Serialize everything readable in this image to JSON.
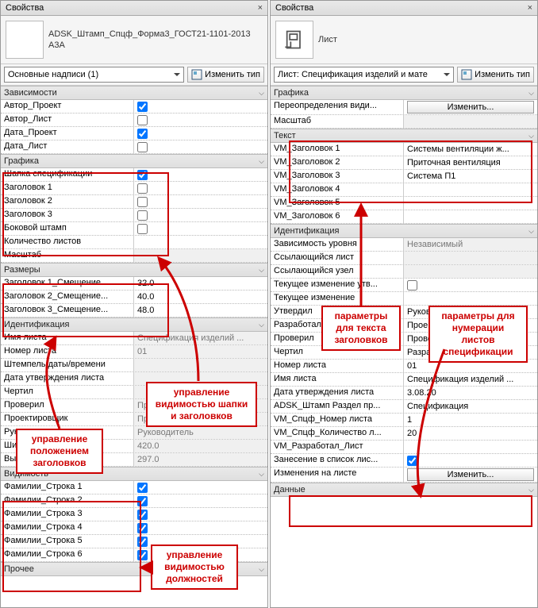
{
  "left": {
    "title": "Свойства",
    "type_name": "ADSK_Штамп_Спцф_Форма3_ГОСТ21-1101-2013\nА3А",
    "selector": "Основные надписи (1)",
    "edit_type": "Изменить тип",
    "sections": {
      "deps": "Зависимости",
      "graphics": "Графика",
      "sizes": "Размеры",
      "ident": "Идентификация",
      "vis": "Видимость",
      "other": "Прочее"
    },
    "rows": {
      "author_project": "Автор_Проект",
      "author_sheet": "Автор_Лист",
      "date_project": "Дата_Проект",
      "date_sheet": "Дата_Лист",
      "spec_header": "Шапка спецификации",
      "head1": "Заголовок 1",
      "head2": "Заголовок 2",
      "head3": "Заголовок 3",
      "side_stamp": "Боковой штамп",
      "sheet_count": "Количество листов",
      "scale": "Масштаб",
      "h1off": "Заголовок 1_Смещение...",
      "h1off_v": "32.0",
      "h2off": "Заголовок 2_Смещение...",
      "h2off_v": "40.0",
      "h3off": "Заголовок 3_Смещение...",
      "h3off_v": "48.0",
      "sheet_name": "Имя листа",
      "sheet_name_v": "Спецификация изделий ...",
      "sheet_num": "Номер листа",
      "sheet_num_v": "01",
      "datestamp": "Штемпель даты/времени",
      "approve_date": "Дата утверждения листа",
      "drew": "Чертил",
      "checked": "Проверил",
      "checked_v": "Проверил",
      "designer": "Проектировщик",
      "designer_v": "Проектировщик",
      "lead": "Руководитель",
      "lead_v": "Руководитель",
      "sheet_w": "Ширина листа",
      "sheet_w_v": "420.0",
      "sheet_h": "Высота листа",
      "sheet_h_v": "297.0",
      "fam1": "Фамилии_Строка 1",
      "fam2": "Фамилии_Строка 2",
      "fam3": "Фамилии_Строка 3",
      "fam4": "Фамилии_Строка 4",
      "fam5": "Фамилии_Строка 5",
      "fam6": "Фамилии_Строка 6"
    }
  },
  "right": {
    "title": "Свойства",
    "type_name": "Лист",
    "selector": "Лист: Спецификация изделий и мате",
    "edit_type": "Изменить тип",
    "sections": {
      "graphics": "Графика",
      "text": "Текст",
      "ident": "Идентификация",
      "data": "Данные"
    },
    "rows": {
      "vis_override": "Переопределения види...",
      "edit_btn": "Изменить...",
      "scale": "Масштаб",
      "vm1": "VM_Заголовок 1",
      "vm1v": "Системы вентиляции ж...",
      "vm2": "VM_Заголовок 2",
      "vm2v": "Приточная вентиляция",
      "vm3": "VM_Заголовок 3",
      "vm3v": "Система П1",
      "vm4": "VM_Заголовок 4",
      "vm5": "VM_Заголовок 5",
      "vm6": "VM_Заголовок 6",
      "dep_level": "Зависимость уровня",
      "dep_level_v": "Независимый",
      "ref_sheet": "Ссылающийся лист",
      "ref_node": "Ссылающийся узел",
      "cur_change_appr": "Текущее изменение утв...",
      "cur_change": "Текущее изменение",
      "approved": "Утвердил",
      "approved_v": "Руководитель",
      "developed": "Разработал",
      "developed_v": "Проектировщик",
      "checked": "Проверил",
      "checked_v": "Проверил",
      "drew": "Чертил",
      "drew_v": "Разработал",
      "sheet_num": "Номер листа",
      "sheet_num_v": "01",
      "sheet_name": "Имя листа",
      "sheet_name_v": "Спецификация изделий ...",
      "approve_date": "Дата утверждения листа",
      "approve_date_v": "3.08.20",
      "adsk_section": "ADSK_Штамп Раздел пр...",
      "adsk_section_v": "Спецификация",
      "vm_num": "VM_Спцф_Номер листа",
      "vm_num_v": "1",
      "vm_count": "VM_Спцф_Количество л...",
      "vm_count_v": "20",
      "vm_dev_sheet": "VM_Разработал_Лист",
      "in_list": "Занесение в список лис...",
      "sheet_changes": "Изменения на листе"
    }
  },
  "annotations": {
    "a1": "управление\nвидимостью шапки\nи заголовков",
    "a2": "управление\nположением\nзаголовков",
    "a3": "управление\nвидимостью\nдолжностей",
    "a4": "параметры\nдля текста\nзаголовков",
    "a5": "параметры для\nнумерации листов\nспецификации"
  }
}
